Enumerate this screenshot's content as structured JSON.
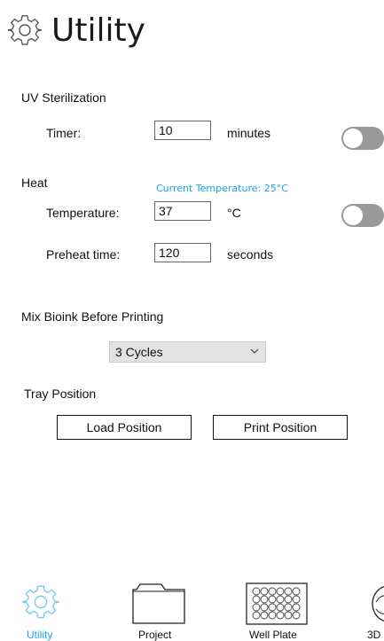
{
  "header": {
    "title": "Utility",
    "icon": "gear-icon"
  },
  "uv": {
    "heading": "UV Sterilization",
    "timer_label": "Timer:",
    "timer_value": "10",
    "timer_unit": "minutes",
    "toggle_on": false
  },
  "heat": {
    "heading": "Heat",
    "current_temp": "Current Temperature: 25°C",
    "temp_label": "Temperature:",
    "temp_value": "37",
    "temp_unit": "°C",
    "preheat_label": "Preheat time:",
    "preheat_value": "120",
    "preheat_unit": "seconds",
    "toggle_on": false
  },
  "mix": {
    "heading": "Mix Bioink Before Printing",
    "selected": "3 Cycles"
  },
  "tray": {
    "heading": "Tray Position",
    "load_label": "Load Position",
    "print_label": "Print Position"
  },
  "nav": {
    "items": [
      {
        "label": "Utility",
        "icon": "gear-icon",
        "active": true
      },
      {
        "label": "Project",
        "icon": "folder-icon",
        "active": false
      },
      {
        "label": "Well Plate",
        "icon": "well-plate-icon",
        "active": false
      },
      {
        "label": "3D",
        "icon": "3d-icon",
        "active": false
      }
    ]
  },
  "colors": {
    "accent": "#1aa3e8",
    "toggle_off": "#9a9a9a",
    "select_bg": "#e3e3e3"
  }
}
